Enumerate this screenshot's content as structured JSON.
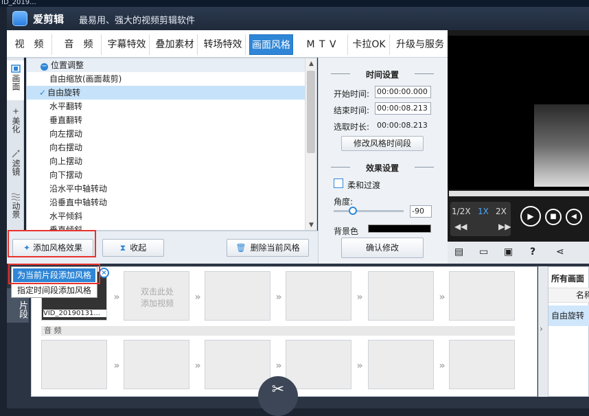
{
  "window_title_fragment": "ID_2019...",
  "app": {
    "name": "爱剪辑",
    "slogan": "最易用、强大的视频剪辑软件"
  },
  "main_tabs": [
    {
      "label": "视　频"
    },
    {
      "label": "音　频"
    },
    {
      "label": "字幕特效"
    },
    {
      "label": "叠加素材"
    },
    {
      "label": "转场特效"
    },
    {
      "label": "画面风格",
      "active": true
    },
    {
      "label": "M T V"
    },
    {
      "label": "卡拉OK"
    },
    {
      "label": "升级与服务"
    }
  ],
  "left_nav": [
    {
      "label": "画面",
      "icon": "film-icon",
      "active": true
    },
    {
      "label": "美化",
      "icon": "magic-wand-icon"
    },
    {
      "label": "滤镜",
      "icon": "sparkle-icon"
    },
    {
      "label": "动景",
      "icon": "waves-icon"
    }
  ],
  "style_list": {
    "category": "位置调整",
    "items": [
      {
        "label": "自由缩放(画面裁剪)"
      },
      {
        "label": "自由旋转",
        "selected": true
      },
      {
        "label": "水平翻转"
      },
      {
        "label": "垂直翻转"
      },
      {
        "label": "向左摆动"
      },
      {
        "label": "向右摆动"
      },
      {
        "label": "向上摆动"
      },
      {
        "label": "向下摆动"
      },
      {
        "label": "沿水平中轴转动"
      },
      {
        "label": "沿垂直中轴转动"
      },
      {
        "label": "水平倾斜"
      },
      {
        "label": "垂直倾斜"
      }
    ]
  },
  "buttons": {
    "add_style": "添加风格效果",
    "collapse": "收起",
    "delete_style": "删除当前风格",
    "confirm": "确认修改",
    "modify_time": "修改风格时间段"
  },
  "time_settings": {
    "title": "时间设置",
    "start_label": "开始时间:",
    "start_value": "00:00:00.000",
    "end_label": "结束时间:",
    "end_value": "00:00:08.213",
    "duration_label": "选取时长:",
    "duration_value": "00:00:08.213"
  },
  "effect_settings": {
    "title": "效果设置",
    "soft_transition": "柔和过渡",
    "angle_label": "角度:",
    "angle_value": "-90",
    "bg_color_label": "背景色"
  },
  "player": {
    "speeds": [
      "1/2X",
      "1X",
      "2X"
    ],
    "active_speed": "1X"
  },
  "popup_menu": {
    "items": [
      "为当前片段添加风格",
      "指定时间段添加风格"
    ]
  },
  "timeline": {
    "clip_name": "VID_20190131...",
    "add_video_hint": "双击此处\n添加视频",
    "audio_label": "音 频",
    "section_label": "片段"
  },
  "right_list": {
    "title": "所有画面",
    "col_name": "名称",
    "item": "自由旋转"
  },
  "colors": {
    "accent": "#2f86d6",
    "highlight": "#e8322b",
    "title_bg": "#1f2a3a"
  }
}
